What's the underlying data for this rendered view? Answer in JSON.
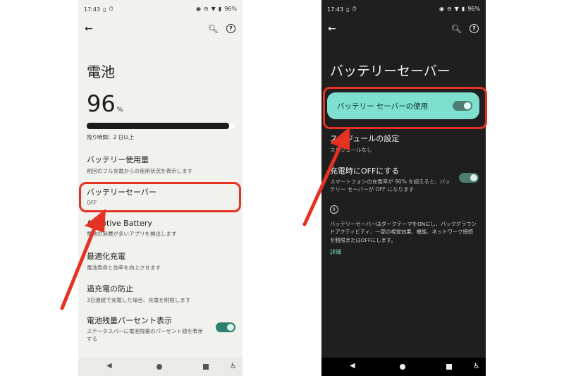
{
  "left": {
    "status": {
      "time": "17:43",
      "battery": "96%"
    },
    "title": "電池",
    "percent": "96",
    "percent_unit": "%",
    "level_fraction": 0.96,
    "remaining": "残り時間：2 日以上",
    "items": [
      {
        "title": "バッテリー使用量",
        "subtitle": "前回のフル充電からの使用状況を表示します"
      },
      {
        "title": "バッテリーセーバー",
        "subtitle": "OFF"
      },
      {
        "title": "Adaptive Battery",
        "subtitle": "電池の消費が多いアプリを検出します"
      },
      {
        "title": "最適化充電",
        "subtitle": "電池寿命と効率を向上させます"
      },
      {
        "title": "過充電の防止",
        "subtitle": "3日連続で充電した場合、充電を制限します"
      },
      {
        "title": "電池残量パーセント表示",
        "subtitle": "ステータスバーに電池残量のパーセント値を表示する",
        "toggle": "on"
      }
    ]
  },
  "right": {
    "status": {
      "time": "17:43",
      "battery": "96%"
    },
    "title": "バッテリーセーバー",
    "use_label": "バッテリー セーバーの使用",
    "items": [
      {
        "title": "スケジュールの設定",
        "subtitle": "スケジュールなし"
      },
      {
        "title": "充電時にOFFにする",
        "subtitle": "スマートフォンの充電率が 90% を超えると、バッテリー セーバーが OFF になります",
        "toggle": "on"
      }
    ],
    "description": "バッテリーセーバーはダークテーマをONにし、バックグラウンドアクティビティ、一部の視覚効果、機能、ネットワーク接続を制限またはOFFにします。",
    "details_link": "詳細"
  },
  "colors": {
    "highlight": "#e53222",
    "accent": "#7de0cf",
    "toggle_on": "#2f7f6e"
  }
}
